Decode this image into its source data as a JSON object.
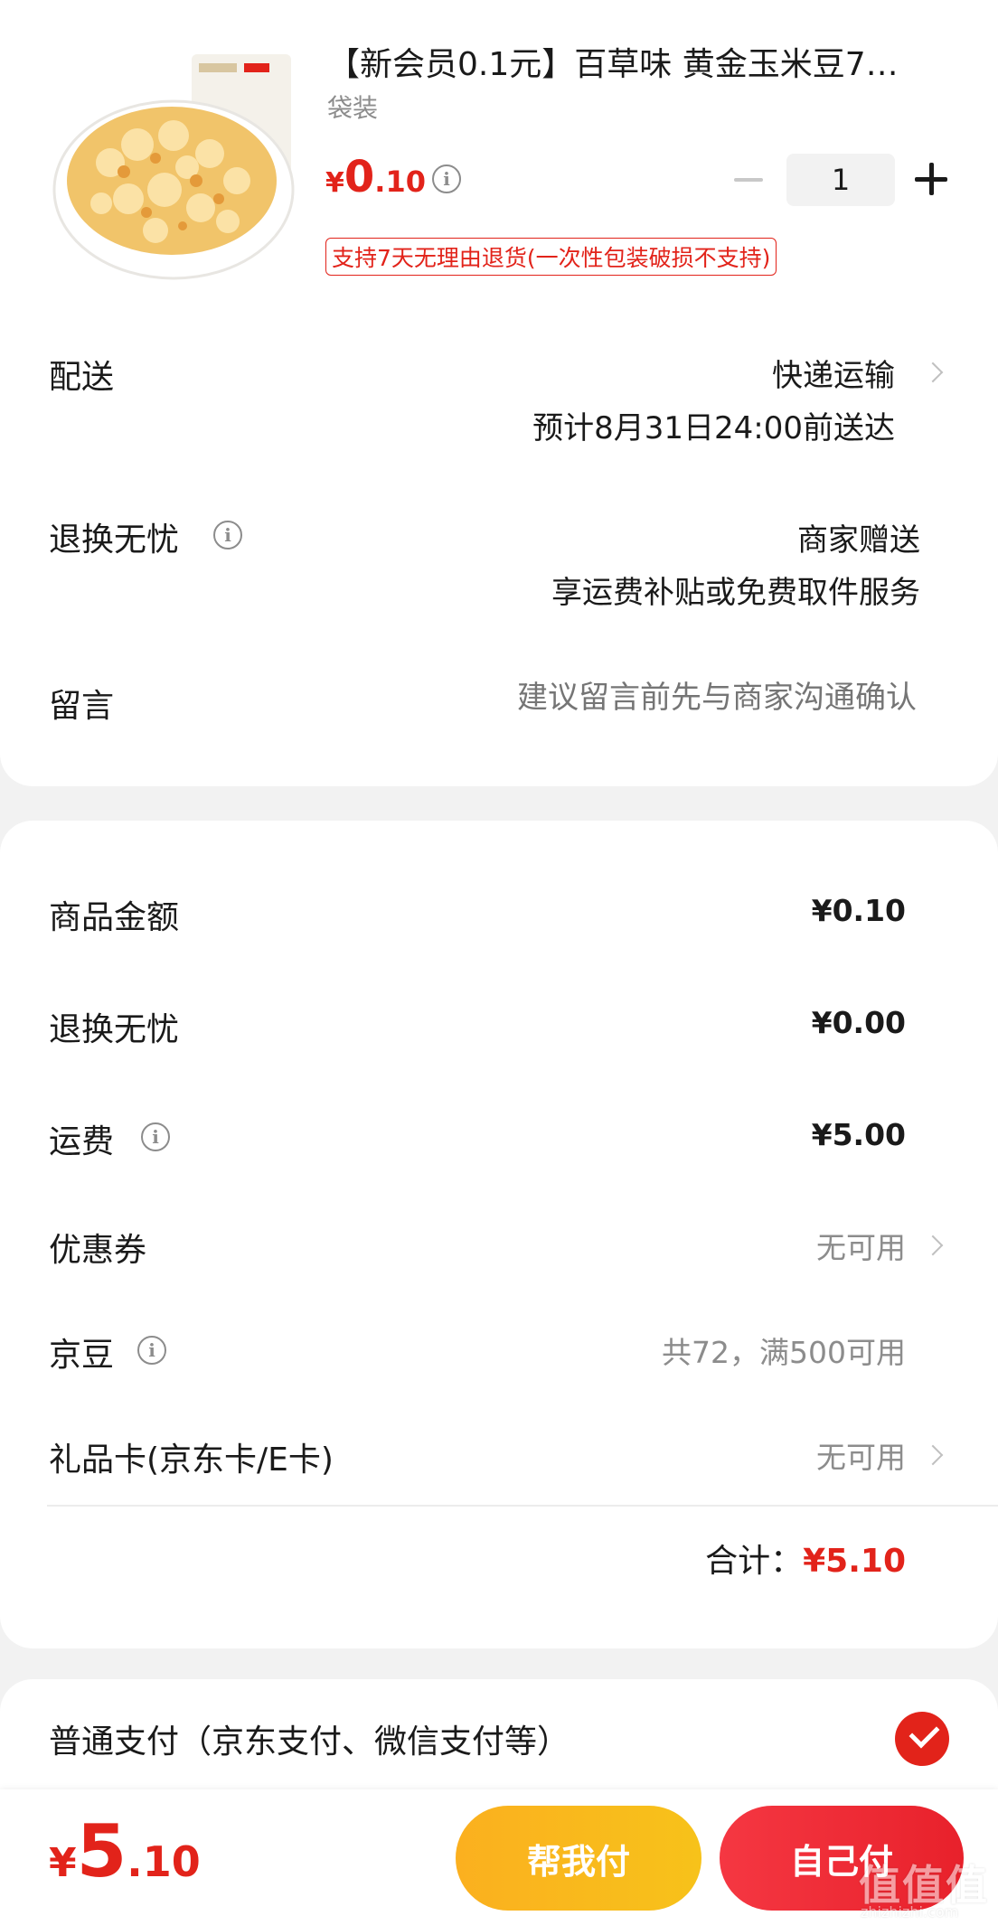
{
  "product": {
    "title": "【新会员0.1元】百草味 黄金玉米豆7…",
    "spec": "袋装",
    "price_yen": "¥",
    "price_int": "0",
    "price_dec": ".10",
    "info_icon": "i",
    "quantity": "1",
    "return_tag": "支持7天无理由退货(一次性包装破损不支持)"
  },
  "delivery": {
    "label": "配送",
    "mode": "快递运输",
    "eta": "预计8月31日24:00前送达"
  },
  "return_service": {
    "label": "退换无忧",
    "info_icon": "i",
    "value": "商家赠送",
    "desc": "享运费补贴或免费取件服务"
  },
  "message": {
    "label": "留言",
    "placeholder": "建议留言前先与商家沟通确认"
  },
  "summary": {
    "goods_amount": {
      "label": "商品金额",
      "value": "¥0.10"
    },
    "return_fee": {
      "label": "退换无忧",
      "value": "¥0.00"
    },
    "shipping": {
      "label": "运费",
      "value": "¥5.00",
      "info_icon": "i"
    },
    "coupon": {
      "label": "优惠券",
      "value": "无可用"
    },
    "jingdou": {
      "label": "京豆",
      "value": "共72，满500可用",
      "info_icon": "i"
    },
    "gift_card": {
      "label": "礼品卡(京东卡/E卡)",
      "value": "无可用"
    },
    "total_label": "合计：",
    "total_value": "¥5.10"
  },
  "payment": {
    "label": "普通支付（京东支付、微信支付等）",
    "selected": true
  },
  "bottom_bar": {
    "price_yen": "¥",
    "price_int": "5",
    "price_dec": ".10",
    "help_pay_label": "帮我付",
    "self_pay_label": "自己付"
  },
  "watermark": {
    "logo": "值值值",
    "url": "zhizhizhi.com"
  },
  "colors": {
    "accent_red": "#e2231a",
    "button_yellow": "#fbb01f",
    "button_red": "#f53742",
    "muted_text": "#8c8c8c",
    "placeholder_text": "#bdbdbd",
    "page_bg": "#f2f2f2"
  }
}
